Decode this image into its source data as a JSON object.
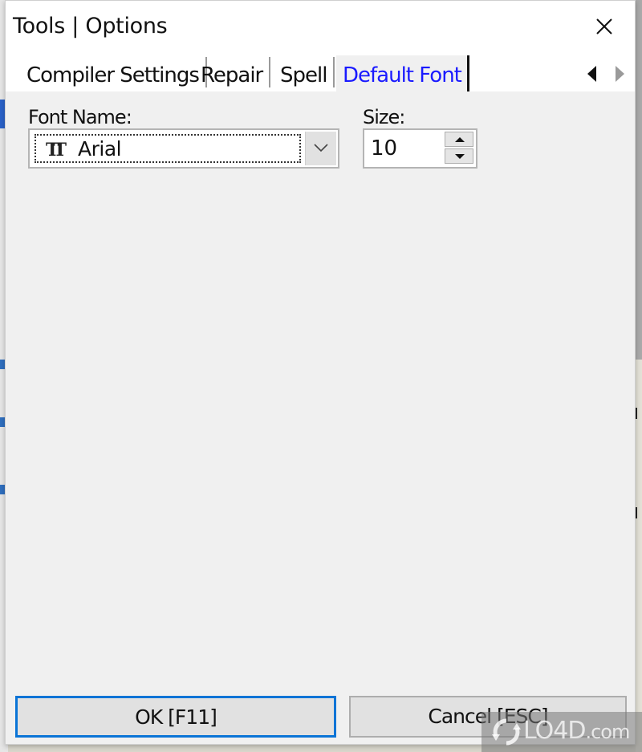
{
  "window": {
    "title": "Tools | Options",
    "close_icon": "close-icon"
  },
  "tabs": [
    {
      "label": "Compiler Settings",
      "active": false
    },
    {
      "label": "Repair",
      "active": false
    },
    {
      "label": "Spell",
      "active": false
    },
    {
      "label": "Default Font",
      "active": true
    }
  ],
  "tab_scroll": {
    "left_icon": "triangle-left-icon",
    "right_icon": "triangle-right-icon",
    "right_enabled": false
  },
  "font_name": {
    "label": "Font Name:",
    "value": "Arial",
    "icon": "truetype-font-icon",
    "dropdown_icon": "chevron-down-icon"
  },
  "size": {
    "label": "Size:",
    "value": "10",
    "up_icon": "arrow-up-icon",
    "down_icon": "arrow-down-icon"
  },
  "buttons": {
    "ok_label": "OK [F11]",
    "cancel_label": "Cancel [ESC]"
  },
  "watermark": {
    "text": "LO4D",
    "suffix": ".com"
  },
  "colors": {
    "active_tab_text": "#1a1aff",
    "ok_border": "#0a74d6",
    "panel_bg": "#f0f0f0"
  }
}
